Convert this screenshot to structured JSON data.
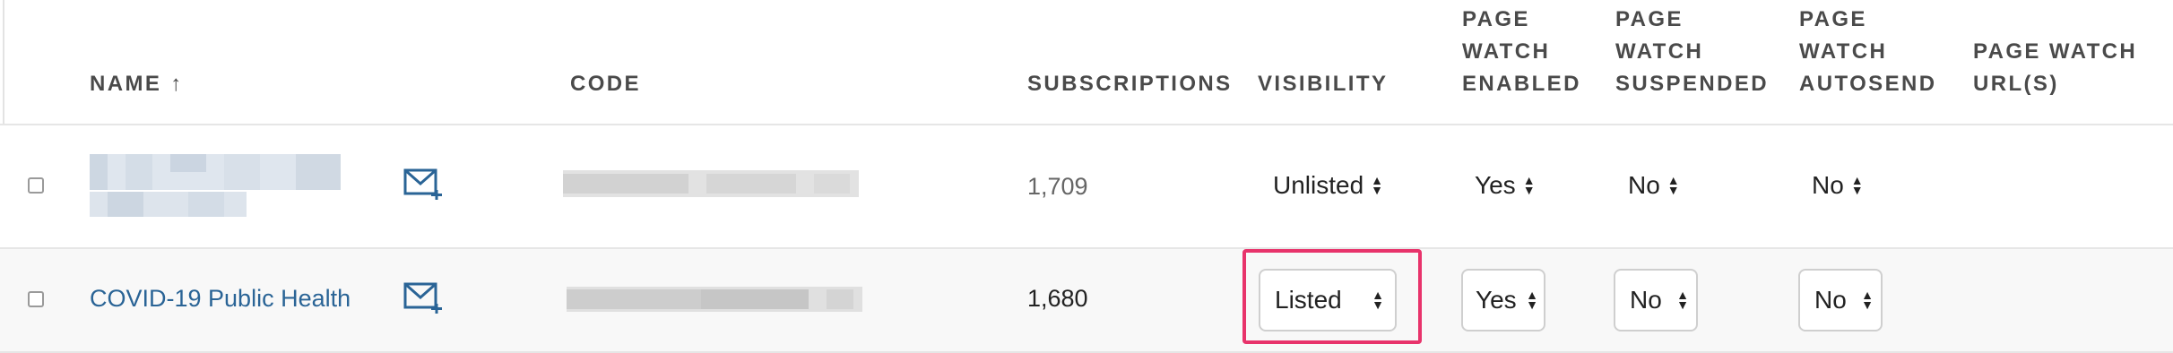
{
  "columns": {
    "name": "NAME",
    "code": "CODE",
    "subscriptions": "SUBSCRIPTIONS",
    "visibility": "VISIBILITY",
    "page_watch_enabled": "PAGE\nWATCH\nENABLED",
    "page_watch_suspended": "PAGE\nWATCH\nSUSPENDED",
    "page_watch_autosend": "PAGE\nWATCH\nAUTOSEND",
    "page_watch_urls": "PAGE WATCH\nURL(S)"
  },
  "sort_indicator": "↑",
  "rows": [
    {
      "name": "",
      "code": "",
      "subscriptions": "1,709",
      "visibility": "Unlisted",
      "page_watch_enabled": "Yes",
      "page_watch_suspended": "No",
      "page_watch_autosend": "No",
      "page_watch_urls": ""
    },
    {
      "name": "COVID-19 Public Health",
      "code": "",
      "subscriptions": "1,680",
      "visibility": "Listed",
      "page_watch_enabled": "Yes",
      "page_watch_suspended": "No",
      "page_watch_autosend": "No",
      "page_watch_urls": ""
    }
  ],
  "icons": {
    "mail": "mail-add-icon",
    "sort": "arrow-up-icon",
    "select": "up-down-caret-icon"
  },
  "colors": {
    "link": "#2a6496",
    "highlight": "#e8336b",
    "header_text": "#4a4a4a",
    "muted_text": "#666666"
  }
}
